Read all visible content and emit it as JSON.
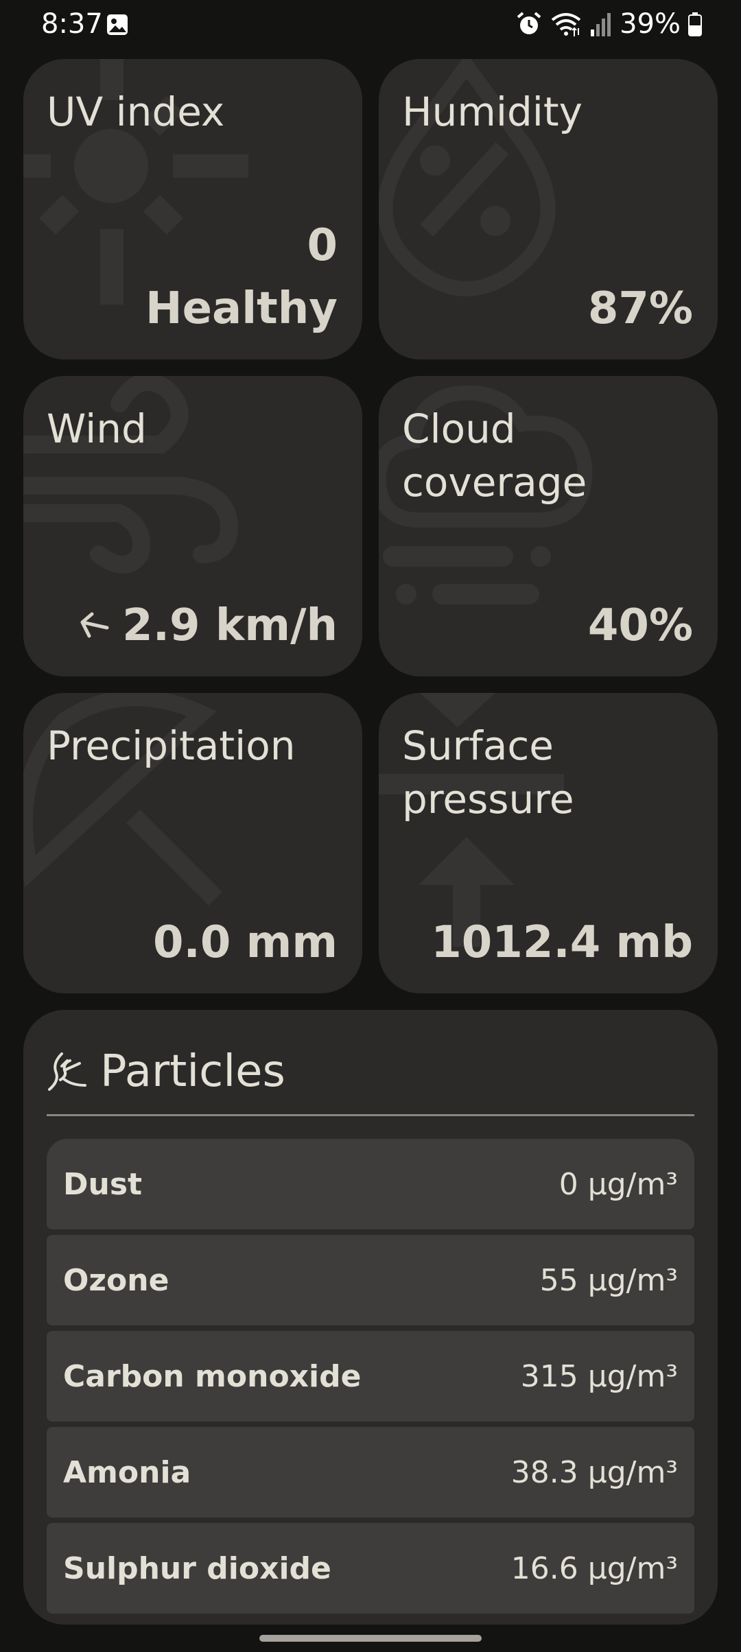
{
  "status_bar": {
    "time": "8:37",
    "battery": "39%",
    "icons": [
      "gallery-icon",
      "alarm-icon",
      "wifi-icon",
      "signal-icon",
      "battery-icon"
    ]
  },
  "cards": {
    "uv": {
      "title": "UV index",
      "value": "0",
      "status": "Healthy",
      "icon": "sun-icon"
    },
    "humidity": {
      "title": "Humidity",
      "value": "87%",
      "icon": "humidity-drop-icon"
    },
    "wind": {
      "title": "Wind",
      "value": "2.9 km/h",
      "icon": "wind-icon",
      "direction_icon": "arrow-left-icon"
    },
    "cloud": {
      "title": "Cloud coverage",
      "value": "40%",
      "icon": "cloud-icon"
    },
    "precipitation": {
      "title": "Precipitation",
      "value": "0.0 mm",
      "icon": "umbrella-icon"
    },
    "pressure": {
      "title": "Surface pressure",
      "value": "1012.4 mb",
      "icon": "pressure-icon"
    }
  },
  "particles": {
    "title": "Particles",
    "icon": "air-particles-icon",
    "rows": [
      {
        "name": "Dust",
        "value": "0 µg/m³"
      },
      {
        "name": "Ozone",
        "value": "55 µg/m³"
      },
      {
        "name": "Carbon monoxide",
        "value": "315 µg/m³"
      },
      {
        "name": "Amonia",
        "value": "38.3 µg/m³"
      },
      {
        "name": "Sulphur dioxide",
        "value": "16.6 µg/m³"
      }
    ]
  },
  "colors": {
    "background": "#131312",
    "card": "#2b2a29",
    "row": "#3e3d3b",
    "text": "#e3e0d6",
    "bg_icon": "#353433"
  }
}
